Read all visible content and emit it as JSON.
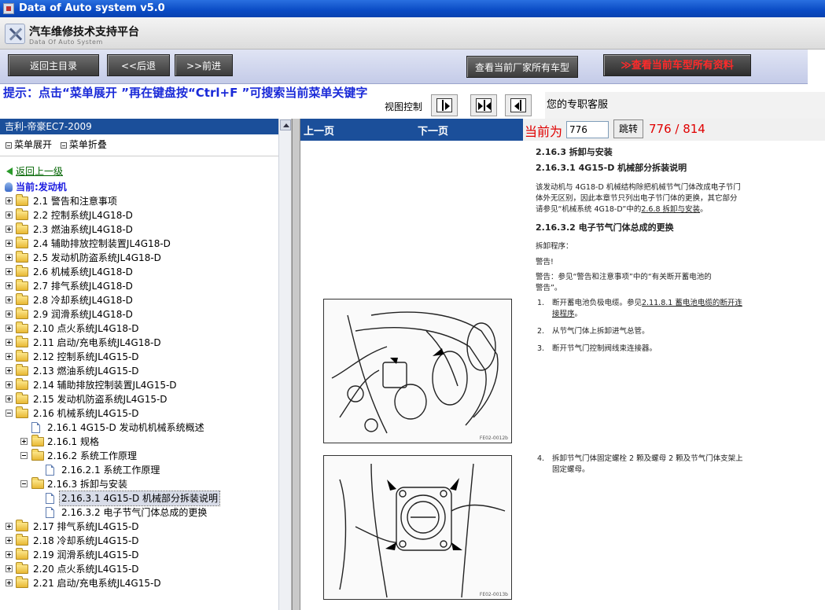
{
  "window": {
    "title": "Data of Auto system v5.0"
  },
  "header": {
    "brand_cn": "汽车维修技术支持平台",
    "brand_en": "Data Of Auto System"
  },
  "toolbar": {
    "home": "返回主目录",
    "back": "<<后退",
    "forward": ">>前进",
    "maker_models": "查看当前厂家所有车型",
    "all_data": "≫查看当前车型所有资料"
  },
  "hint": "提示：点击“菜单展开 ”再在键盘按“Ctrl+F ”可搜索当前菜单关键字",
  "view_control": {
    "label": "视图控制"
  },
  "service": "您的专职客服",
  "left": {
    "car": "吉利-帝豪EC7-2009",
    "expand": "菜单展开",
    "collapse": "菜单折叠",
    "back_up": "返回上一级",
    "current": "当前:发动机",
    "tree": [
      "2.1 警告和注意事项",
      "2.2 控制系统JL4G18-D",
      "2.3 燃油系统JL4G18-D",
      "2.4 辅助排放控制装置JL4G18-D",
      "2.5 发动机防盗系统JL4G18-D",
      "2.6 机械系统JL4G18-D",
      "2.7 排气系统JL4G18-D",
      "2.8 冷却系统JL4G18-D",
      "2.9 润滑系统JL4G18-D",
      "2.10 点火系统JL4G18-D",
      "2.11 启动/充电系统JL4G18-D",
      "2.12 控制系统JL4G15-D",
      "2.13 燃油系统JL4G15-D",
      "2.14 辅助排放控制装置JL4G15-D",
      "2.15 发动机防盗系统JL4G15-D",
      "2.16 机械系统JL4G15-D",
      "2.16.1 4G15-D 发动机机械系统概述",
      "2.16.1 规格",
      "2.16.2 系统工作原理",
      "2.16.2.1 系统工作原理",
      "2.16.3 拆卸与安装",
      "2.16.3.1 4G15-D 机械部分拆装说明",
      "2.16.3.2 电子节气门体总成的更换",
      "2.17 排气系统JL4G15-D",
      "2.18 冷却系统JL4G15-D",
      "2.19 润滑系统JL4G15-D",
      "2.20 点火系统JL4G15-D",
      "2.21 启动/充电系统JL4G15-D"
    ]
  },
  "nav": {
    "prev": "上一页",
    "next": "下一页",
    "current_label": "当前为",
    "page_value": "776",
    "go": "跳转",
    "page_count": "776 / 814"
  },
  "doc": {
    "h1": "2.16.3 拆卸与安装",
    "h2": "2.16.3.1 4G15-D 机械部分拆装说明",
    "p1a": "该发动机与 4G18-D 机械结构除把机械节气门体改成电子节门",
    "p1b": "体外无区别，因此本章节只列出电子节门体的更换，其它部分",
    "p1c_pre": "请参见“机械系统 4G18-D”中的",
    "p1c_link": "2.6.8 拆卸与安装",
    "p1c_post": "。",
    "h3": "2.16.3.2 电子节气门体总成的更换",
    "proc": "拆卸程序：",
    "warn": "警告!",
    "warn2a": "警告：参见“警告和注意事项”中的“有关断开蓄电池的",
    "warn2b": "警告”。",
    "s1n": "1.",
    "s1a_pre": "断开蓄电池负极电缆。参见",
    "s1a_link": "2.11.8.1 蓄电池电缆的断开连",
    "s1b_link": "接程序",
    "s1b_post": "。",
    "s2n": "2.",
    "s2": "从节气门体上拆卸进气总管。",
    "s3n": "3.",
    "s3": "断开节气门控制阀线束连接器。",
    "s4n": "4.",
    "s4a": "拆卸节气门体固定螺栓 2 颗及螺母 2 颗及节气门体支架上",
    "s4b": "固定螺母。",
    "fig1": "FE02-0012b",
    "fig2": "FE02-0013b"
  }
}
